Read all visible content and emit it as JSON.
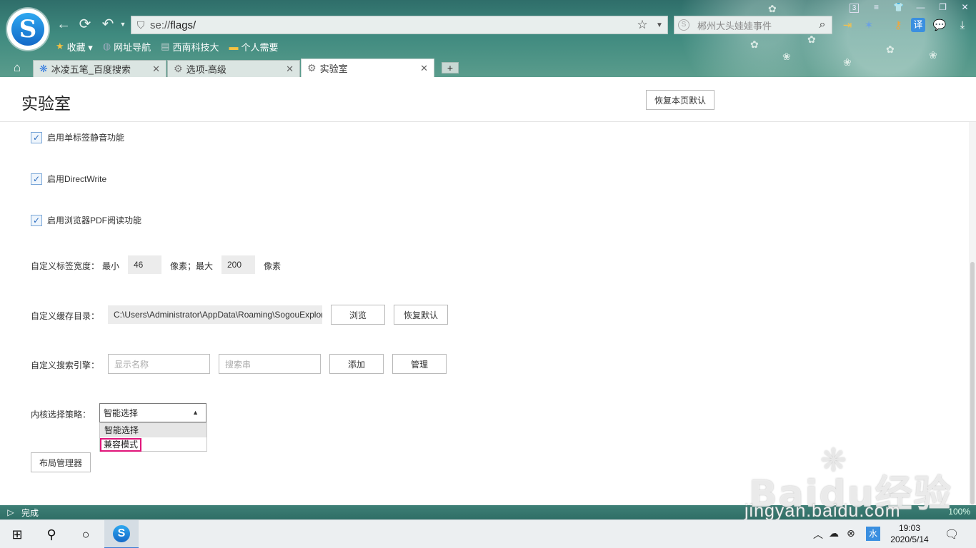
{
  "browser": {
    "address_scheme": "se://",
    "address_path": "flags/",
    "search_query": "郴州大头娃娃事件",
    "tab_count_badge": "3",
    "bookmarks": [
      {
        "icon": "star-icon",
        "label": "收藏 ▾"
      },
      {
        "icon": "globe-icon",
        "label": "网址导航"
      },
      {
        "icon": "page-icon",
        "label": "西南科技大"
      },
      {
        "icon": "folder-icon",
        "label": "个人需要"
      }
    ],
    "tabs": [
      {
        "label": "冰凌五笔_百度搜索",
        "icon": "baidu-paw-icon",
        "active": false
      },
      {
        "label": "选项-高级",
        "icon": "gear-icon",
        "active": false
      },
      {
        "label": "实验室",
        "icon": "gear-icon",
        "active": true
      }
    ],
    "translate_label": "译"
  },
  "page": {
    "title": "实验室",
    "restore_page_default": "恢复本页默认",
    "checkboxes": [
      {
        "label": "启用单标签静音功能",
        "checked": true
      },
      {
        "label": "启用DirectWrite",
        "checked": true
      },
      {
        "label": "启用浏览器PDF阅读功能",
        "checked": true
      }
    ],
    "tab_width": {
      "label": "自定义标签宽度：",
      "min_label": "最小",
      "min_value": "46",
      "unit_sep": "像素；最大",
      "max_value": "200",
      "unit": "像素"
    },
    "cache_dir": {
      "label": "自定义缓存目录：",
      "value": "C:\\Users\\Administrator\\AppData\\Roaming\\SogouExplorer",
      "browse": "浏览",
      "restore": "恢复默认"
    },
    "search_engine": {
      "label": "自定义搜索引擎：",
      "name_placeholder": "显示名称",
      "string_placeholder": "搜索串",
      "add": "添加",
      "manage": "管理"
    },
    "kernel": {
      "label": "内核选择策略：",
      "selected": "智能选择",
      "options": [
        "智能选择",
        "兼容模式"
      ]
    },
    "layout_manager": "布局管理器"
  },
  "status": {
    "text": "完成",
    "zoom": "100%"
  },
  "watermark": {
    "brand": "Baidu经验",
    "url": "jingyan.baidu.com"
  },
  "taskbar": {
    "time": "19:03",
    "date": "2020/5/14",
    "ime": "水"
  }
}
